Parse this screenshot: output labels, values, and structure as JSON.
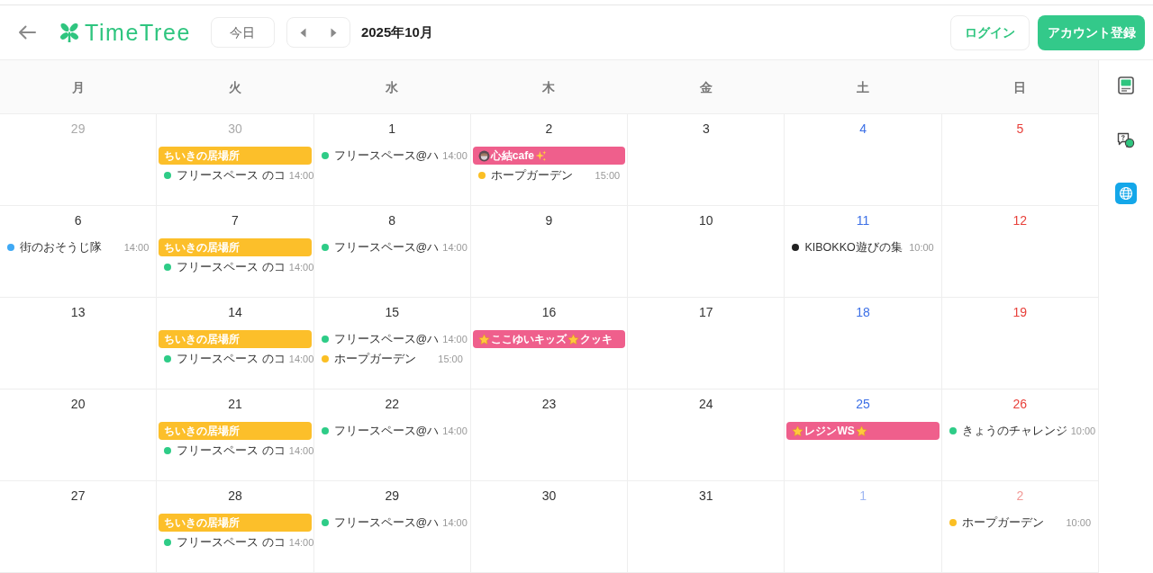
{
  "header": {
    "logo_text": "TimeTree",
    "today_button": "今日",
    "month_label": "2025年10月",
    "login_button": "ログイン",
    "signup_button": "アカウント登録"
  },
  "weekdays": [
    "月",
    "火",
    "水",
    "木",
    "金",
    "土",
    "日"
  ],
  "weeks": [
    {
      "days": [
        {
          "date": "29",
          "outside_month": true
        },
        {
          "date": "30",
          "outside_month": true,
          "events": [
            {
              "kind": "bar",
              "color": "#fcbf2a",
              "segments": [
                {
                  "kind": "text",
                  "text": "ちいきの居場所"
                }
              ]
            },
            {
              "kind": "dot",
              "color": "#2ecc87",
              "title": "フリースペース のコ",
              "time": "14:00"
            }
          ]
        },
        {
          "date": "1",
          "outside_month": false,
          "events": [
            {
              "kind": "dot",
              "color": "#2ecc87",
              "title": "フリースペース@ハ",
              "time": "14:00"
            }
          ]
        },
        {
          "date": "2",
          "outside_month": false,
          "events": [
            {
              "kind": "bar",
              "color": "#ef5f8c",
              "segments": [
                {
                  "kind": "cup"
                },
                {
                  "kind": "text",
                  "text": "心結cafe"
                },
                {
                  "kind": "sparkle"
                }
              ]
            },
            {
              "kind": "dot",
              "color": "#fbbf24",
              "title": "ホープガーデン",
              "time": "15:00"
            }
          ]
        },
        {
          "date": "3",
          "outside_month": false
        },
        {
          "date": "4",
          "outside_month": false
        },
        {
          "date": "5",
          "outside_month": false
        }
      ]
    },
    {
      "days": [
        {
          "date": "6",
          "outside_month": false,
          "events": [
            {
              "kind": "dot",
              "color": "#3fa9f5",
              "title": "街のおそうじ隊",
              "time": "14:00"
            }
          ]
        },
        {
          "date": "7",
          "outside_month": false,
          "events": [
            {
              "kind": "bar",
              "color": "#fcbf2a",
              "segments": [
                {
                  "kind": "text",
                  "text": "ちいきの居場所"
                }
              ]
            },
            {
              "kind": "dot",
              "color": "#2ecc87",
              "title": "フリースペース のコ",
              "time": "14:00"
            }
          ]
        },
        {
          "date": "8",
          "outside_month": false,
          "events": [
            {
              "kind": "dot",
              "color": "#2ecc87",
              "title": "フリースペース@ハ",
              "time": "14:00"
            }
          ]
        },
        {
          "date": "9",
          "outside_month": false
        },
        {
          "date": "10",
          "outside_month": false
        },
        {
          "date": "11",
          "outside_month": false,
          "events": [
            {
              "kind": "dot",
              "color": "#222222",
              "title": "KIBOKKO遊びの集",
              "time": "10:00"
            }
          ]
        },
        {
          "date": "12",
          "outside_month": false
        }
      ]
    },
    {
      "days": [
        {
          "date": "13",
          "outside_month": false
        },
        {
          "date": "14",
          "outside_month": false,
          "events": [
            {
              "kind": "bar",
              "color": "#fcbf2a",
              "segments": [
                {
                  "kind": "text",
                  "text": "ちいきの居場所"
                }
              ]
            },
            {
              "kind": "dot",
              "color": "#2ecc87",
              "title": "フリースペース のコ",
              "time": "14:00"
            }
          ]
        },
        {
          "date": "15",
          "outside_month": false,
          "events": [
            {
              "kind": "dot",
              "color": "#2ecc87",
              "title": "フリースペース@ハ",
              "time": "14:00"
            },
            {
              "kind": "dot",
              "color": "#fbbf24",
              "title": "ホープガーデン",
              "time": "15:00"
            }
          ]
        },
        {
          "date": "16",
          "outside_month": false,
          "events": [
            {
              "kind": "bar",
              "color": "#ef5f8c",
              "segments": [
                {
                  "kind": "star"
                },
                {
                  "kind": "text",
                  "text": "ここゆいキッズ"
                },
                {
                  "kind": "star"
                },
                {
                  "kind": "text",
                  "text": "クッキ"
                }
              ]
            }
          ]
        },
        {
          "date": "17",
          "outside_month": false
        },
        {
          "date": "18",
          "outside_month": false
        },
        {
          "date": "19",
          "outside_month": false
        }
      ]
    },
    {
      "days": [
        {
          "date": "20",
          "outside_month": false
        },
        {
          "date": "21",
          "outside_month": false,
          "events": [
            {
              "kind": "bar",
              "color": "#fcbf2a",
              "segments": [
                {
                  "kind": "text",
                  "text": "ちいきの居場所"
                }
              ]
            },
            {
              "kind": "dot",
              "color": "#2ecc87",
              "title": "フリースペース のコ",
              "time": "14:00"
            }
          ]
        },
        {
          "date": "22",
          "outside_month": false,
          "events": [
            {
              "kind": "dot",
              "color": "#2ecc87",
              "title": "フリースペース@ハ",
              "time": "14:00"
            }
          ]
        },
        {
          "date": "23",
          "outside_month": false
        },
        {
          "date": "24",
          "outside_month": false
        },
        {
          "date": "25",
          "outside_month": false,
          "events": [
            {
              "kind": "bar",
              "color": "#ef5f8c",
              "segments": [
                {
                  "kind": "star"
                },
                {
                  "kind": "text",
                  "text": "レジンWS"
                },
                {
                  "kind": "star"
                }
              ]
            }
          ]
        },
        {
          "date": "26",
          "outside_month": false,
          "events": [
            {
              "kind": "dot",
              "color": "#2ecc87",
              "title": "きょうのチャレンジ",
              "time": "10:00"
            }
          ]
        }
      ]
    },
    {
      "days": [
        {
          "date": "27",
          "outside_month": false
        },
        {
          "date": "28",
          "outside_month": false,
          "events": [
            {
              "kind": "bar",
              "color": "#fcbf2a",
              "segments": [
                {
                  "kind": "text",
                  "text": "ちいきの居場所"
                }
              ]
            },
            {
              "kind": "dot",
              "color": "#2ecc87",
              "title": "フリースペース のコ",
              "time": "14:00"
            }
          ]
        },
        {
          "date": "29",
          "outside_month": false,
          "events": [
            {
              "kind": "dot",
              "color": "#2ecc87",
              "title": "フリースペース@ハ",
              "time": "14:00"
            }
          ]
        },
        {
          "date": "30",
          "outside_month": false
        },
        {
          "date": "31",
          "outside_month": false
        },
        {
          "date": "1",
          "outside_month": true
        },
        {
          "date": "2",
          "outside_month": true,
          "events": [
            {
              "kind": "dot",
              "color": "#fbbf24",
              "title": "ホープガーデン",
              "time": "10:00"
            }
          ]
        }
      ]
    }
  ]
}
